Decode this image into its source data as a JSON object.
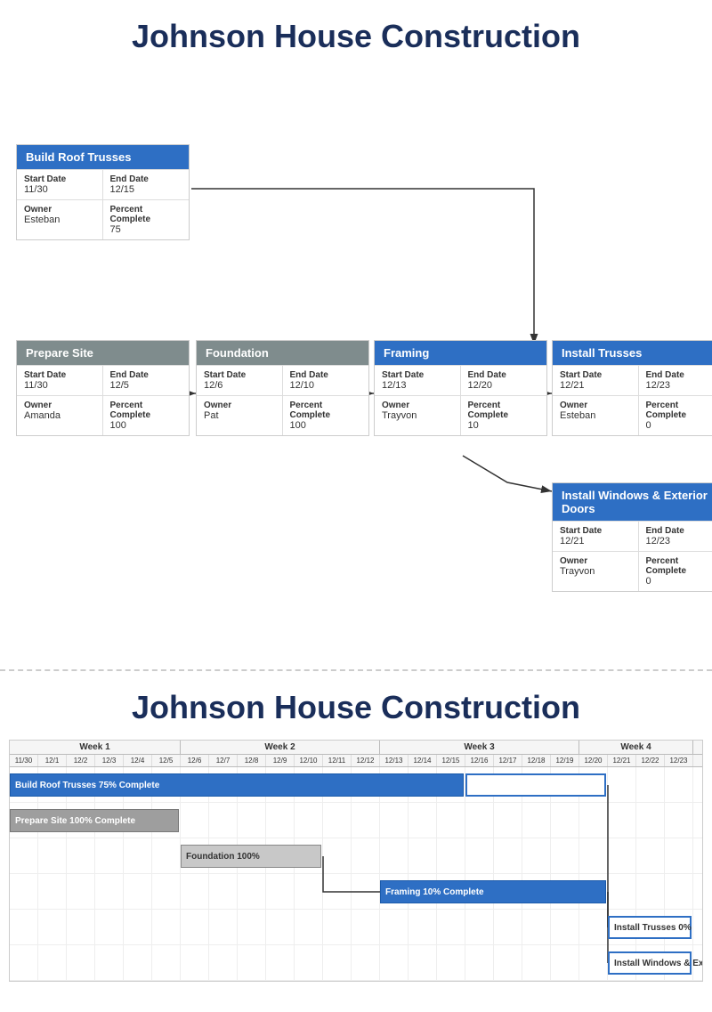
{
  "title": "Johnson House Construction",
  "section1": {
    "tasks": [
      {
        "id": "build-roof",
        "name": "Build Roof Trusses",
        "headerColor": "blue",
        "startDate": "11/30",
        "endDate": "12/15",
        "owner": "Esteban",
        "percentComplete": "75",
        "posLeft": 8,
        "posTop": 80
      },
      {
        "id": "prepare-site",
        "name": "Prepare Site",
        "headerColor": "gray",
        "startDate": "11/30",
        "endDate": "12/5",
        "owner": "Amanda",
        "percentComplete": "100",
        "posLeft": 8,
        "posTop": 300
      },
      {
        "id": "foundation",
        "name": "Foundation",
        "headerColor": "gray",
        "startDate": "12/6",
        "endDate": "12/10",
        "owner": "Pat",
        "percentComplete": "100",
        "posLeft": 210,
        "posTop": 300
      },
      {
        "id": "framing",
        "name": "Framing",
        "headerColor": "blue",
        "startDate": "12/13",
        "endDate": "12/20",
        "owner": "Trayvon",
        "percentComplete": "10",
        "posLeft": 410,
        "posTop": 300
      },
      {
        "id": "install-trusses",
        "name": "Install Trusses",
        "headerColor": "blue",
        "startDate": "12/21",
        "endDate": "12/23",
        "owner": "Esteban",
        "percentComplete": "0",
        "posLeft": 610,
        "posTop": 300
      },
      {
        "id": "install-windows",
        "name": "Install Windows & Exterior Doors",
        "headerColor": "blue",
        "startDate": "12/21",
        "endDate": "12/23",
        "owner": "Trayvon",
        "percentComplete": "0",
        "posLeft": 610,
        "posTop": 460
      }
    ]
  },
  "section2": {
    "weeks": [
      {
        "label": "Week 1",
        "cols": 6
      },
      {
        "label": "Week 2",
        "cols": 7
      },
      {
        "label": "Week 3",
        "cols": 7
      },
      {
        "label": "Week 4",
        "cols": 4
      }
    ],
    "dates": [
      "11/30",
      "12/1",
      "12/2",
      "12/3",
      "12/4",
      "12/5",
      "12/6",
      "12/7",
      "12/8",
      "12/9",
      "12/10",
      "12/11",
      "12/12",
      "12/13",
      "12/14",
      "12/15",
      "12/16",
      "12/17",
      "12/18",
      "12/19",
      "12/20",
      "12/21",
      "12/22",
      "12/23"
    ],
    "bars": [
      {
        "label": "Build Roof Trusses",
        "complete": "75% Complete",
        "startCol": 0,
        "span": 16,
        "type": "blue",
        "row": 0
      },
      {
        "label": "",
        "complete": "",
        "startCol": 16,
        "span": 5,
        "type": "blue-outline",
        "row": 0
      },
      {
        "label": "Prepare Site",
        "complete": "100% Complete",
        "startCol": 0,
        "span": 6,
        "type": "gray",
        "row": 1
      },
      {
        "label": "Foundation",
        "complete": "100%",
        "startCol": 6,
        "span": 5,
        "type": "gray-outline",
        "row": 2
      },
      {
        "label": "Framing",
        "complete": "10% Complete",
        "startCol": 13,
        "span": 8,
        "type": "blue",
        "row": 3
      },
      {
        "label": "Install Trusses",
        "complete": "0%",
        "startCol": 21,
        "span": 3,
        "type": "blue-outline",
        "row": 4
      },
      {
        "label": "Install Windows & Exterior Doors",
        "complete": "",
        "startCol": 21,
        "span": 3,
        "type": "blue-outline",
        "row": 5
      }
    ]
  }
}
